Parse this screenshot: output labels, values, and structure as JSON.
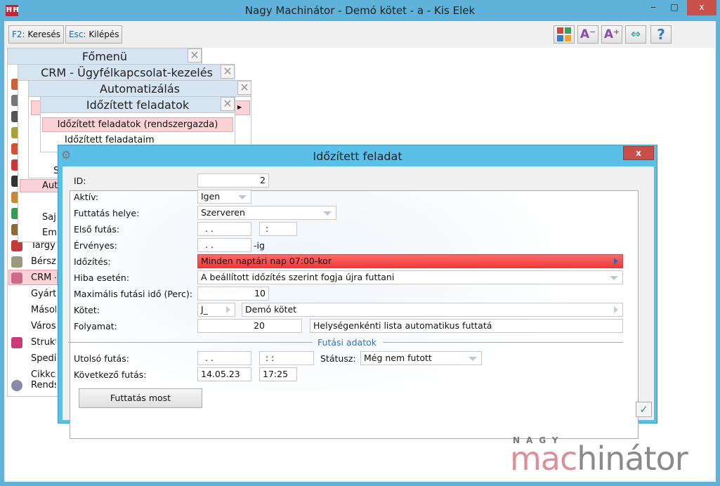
{
  "window": {
    "title": "Nagy Machinátor - Demó kötet - a - Kis Elek",
    "minimize": "‒",
    "maximize": "□",
    "close": "x"
  },
  "toolbar": {
    "search_key": "F2:",
    "search_label": "Keresés",
    "exit_key": "Esc:",
    "exit_label": "Kilépés",
    "help": "?"
  },
  "panels": {
    "main": {
      "title": "Főmenü",
      "items": [
        "Tárgyi",
        "Bérszá",
        "CRM -",
        "Gyárt",
        "Másol",
        "Város",
        "Strukt",
        "Spedíc",
        "Cikkcs",
        "Rends"
      ]
    },
    "crm": {
      "title": "CRM - Ügyfélkapcsolat-kezelés",
      "items": [
        "Aut",
        "Saj",
        "Em"
      ]
    },
    "auto": {
      "title": "Automatizálás",
      "items": [
        "S"
      ]
    },
    "scheduled": {
      "title": "Időzített feladatok",
      "items": [
        "Időzített feladatok (rendszergazda)",
        "Időzített feladataim"
      ]
    }
  },
  "dialog": {
    "title": "Időzített feladat",
    "labels": {
      "id": "ID:",
      "active": "Aktív:",
      "location": "Futtatás helye:",
      "first_run": "Első futás:",
      "valid": "Érvényes:",
      "valid_suffix": "-ig",
      "schedule": "Időzítés:",
      "on_error": "Hiba esetén:",
      "max_time": "Maximális futási idő (Perc):",
      "volume": "Kötet:",
      "process": "Folyamat:",
      "last_run": "Utolsó futás:",
      "status": "Státusz:",
      "next_run": "Következő futás:"
    },
    "values": {
      "id": "2",
      "active": "Igen",
      "location": "Szerveren",
      "first_run_date": " . .",
      "first_run_time": " :",
      "valid_date": " . .",
      "schedule": "Minden  naptári nap  07:00-kor",
      "on_error": "A beállított időzítés szerint fogja újra futtani",
      "max_time": "10",
      "volume_code": "J_",
      "volume_name": "Demó kötet",
      "process_id": "20",
      "process_name": "Helységenkénti lista automatikus futtatá",
      "last_run_date": " . .",
      "last_run_time": " : :",
      "status": "Még nem futott",
      "next_run_date": "14.05.23",
      "next_run_time": "17:25"
    },
    "section": "Futási adatok",
    "run_now": "Futtatás most",
    "ok": "✓",
    "close": "x"
  },
  "logo": {
    "top": "NAGY",
    "brand_a": "mac",
    "brand_b": "hinátor"
  }
}
